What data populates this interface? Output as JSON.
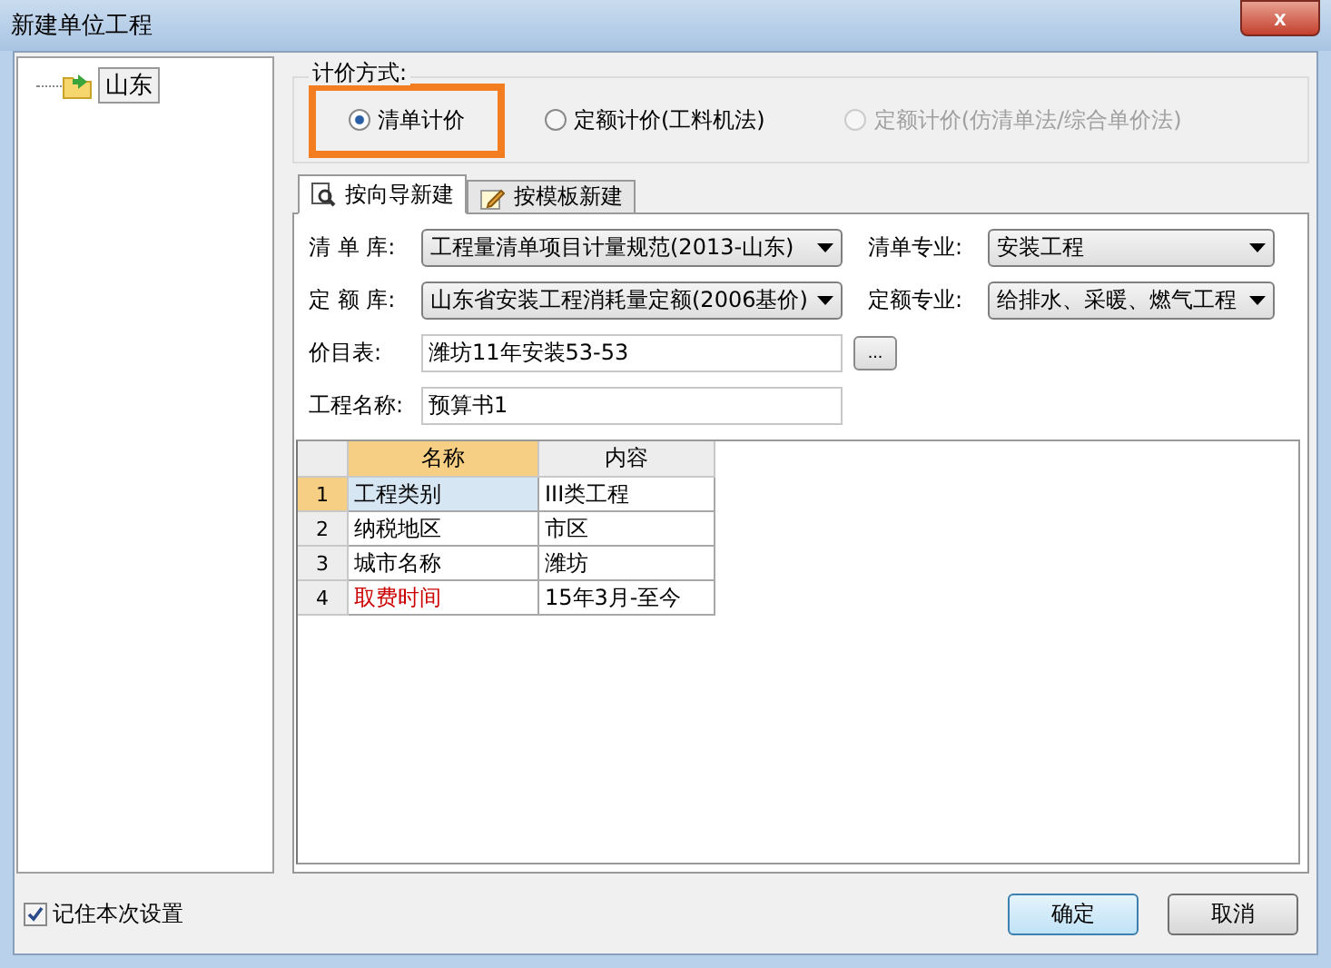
{
  "window": {
    "title": "新建单位工程",
    "close": "x"
  },
  "tree": {
    "items": [
      {
        "label": "山东",
        "selected": true
      }
    ]
  },
  "pricing": {
    "legend": "计价方式:",
    "options": [
      {
        "label": "清单计价",
        "selected": true,
        "disabled": false,
        "highlighted": true
      },
      {
        "label": "定额计价(工料机法)",
        "selected": false,
        "disabled": false,
        "highlighted": false
      },
      {
        "label": "定额计价(仿清单法/综合单价法)",
        "selected": false,
        "disabled": true,
        "highlighted": false
      }
    ]
  },
  "tabs": [
    {
      "label": "按向导新建",
      "selected": true
    },
    {
      "label": "按模板新建",
      "selected": false
    }
  ],
  "form": {
    "qingdan_lib": {
      "label": "清 单 库:",
      "value": "工程量清单项目计量规范(2013-山东)"
    },
    "qingdan_major": {
      "label": "清单专业:",
      "value": "安装工程"
    },
    "dinge_lib": {
      "label": "定 额 库:",
      "value": "山东省安装工程消耗量定额(2006基价)"
    },
    "dinge_major": {
      "label": "定额专业:",
      "value": "给排水、采暖、燃气工程"
    },
    "price_table": {
      "label": "价目表:",
      "value": "潍坊11年安装53-53",
      "browse": "..."
    },
    "project_name": {
      "label": "工程名称:",
      "value": "预算书1"
    }
  },
  "table": {
    "columns": [
      "名称",
      "内容"
    ],
    "rows": [
      {
        "index": "1",
        "name": "工程类别",
        "value": "III类工程",
        "selected": true,
        "color": "#000000"
      },
      {
        "index": "2",
        "name": "纳税地区",
        "value": "市区",
        "selected": false,
        "color": "#000000"
      },
      {
        "index": "3",
        "name": "城市名称",
        "value": "潍坊",
        "selected": false,
        "color": "#000000"
      },
      {
        "index": "4",
        "name": "取费时间",
        "value": "15年3月-至今",
        "selected": false,
        "color": "#cc0000"
      }
    ]
  },
  "remember": {
    "label": "记住本次设置",
    "checked": true
  },
  "buttons": [
    {
      "label": "确定",
      "default": true
    },
    {
      "label": "取消",
      "default": false
    }
  ]
}
